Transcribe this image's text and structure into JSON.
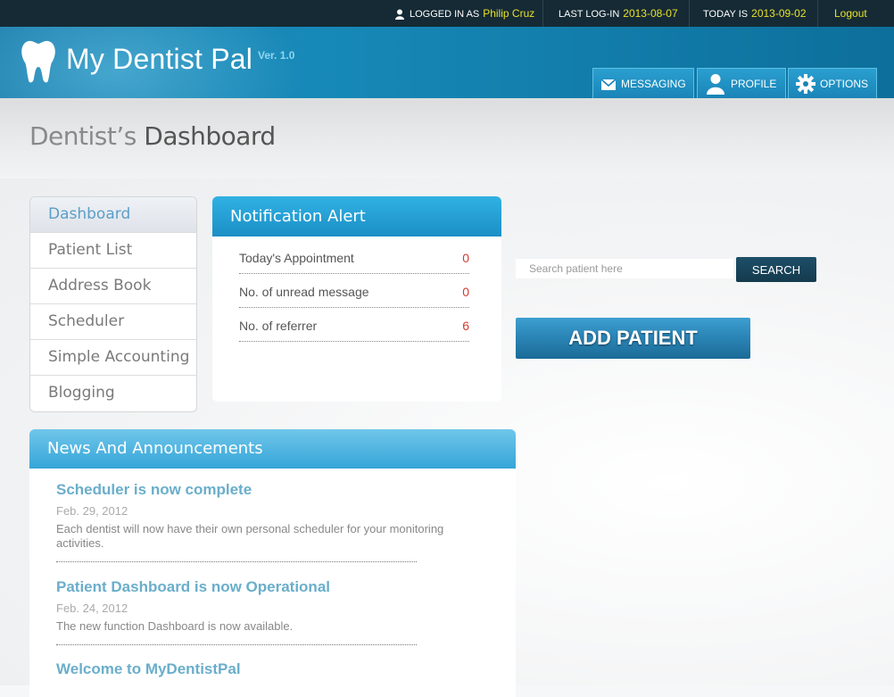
{
  "topbar": {
    "logged_in_label": "LOGGED IN AS",
    "user_name": "Philip Cruz",
    "last_login_label": "LAST LOG-IN",
    "last_login_date": "2013-08-07",
    "today_label": "TODAY IS",
    "today_date": "2013-09-02",
    "logout_label": "Logout"
  },
  "header": {
    "app_name": "My Dentist Pal",
    "version": "Ver. 1.0",
    "nav": [
      {
        "label": "MESSAGING",
        "icon": "envelope-icon"
      },
      {
        "label": "PROFILE",
        "icon": "user-icon"
      },
      {
        "label": "OPTIONS",
        "icon": "gear-icon"
      }
    ]
  },
  "page": {
    "title_first": "Dentist’s",
    "title_rest": " Dashboard"
  },
  "sidebar": {
    "items": [
      {
        "label": "Dashboard",
        "active": true
      },
      {
        "label": "Patient List"
      },
      {
        "label": "Address Book"
      },
      {
        "label": "Scheduler"
      },
      {
        "label": "Simple Accounting"
      },
      {
        "label": "Blogging"
      }
    ]
  },
  "notification": {
    "title": "Notification Alert",
    "rows": [
      {
        "label": "Today's Appointment",
        "value": "0"
      },
      {
        "label": "No. of unread message",
        "value": "0"
      },
      {
        "label": "No. of referrer",
        "value": "6"
      }
    ]
  },
  "search": {
    "placeholder": "Search patient here",
    "value": "",
    "button_label": "SEARCH"
  },
  "add_patient": {
    "label": "ADD PATIENT"
  },
  "news": {
    "title": "News And Announcements",
    "items": [
      {
        "title": "Scheduler is now complete",
        "date": "Feb. 29, 2012",
        "body": "Each dentist will now have their own personal scheduler for your monitoring activities."
      },
      {
        "title": "Patient Dashboard is now Operational",
        "date": "Feb. 24, 2012",
        "body": "The new function Dashboard is now available."
      },
      {
        "title": "Welcome to MyDentistPal",
        "date": "",
        "body": ""
      }
    ]
  },
  "colors": {
    "accent_yellow": "#e9e02a",
    "header_blue": "#1789b8",
    "alert_red": "#d23a2f",
    "link_blue": "#6aaecb"
  }
}
